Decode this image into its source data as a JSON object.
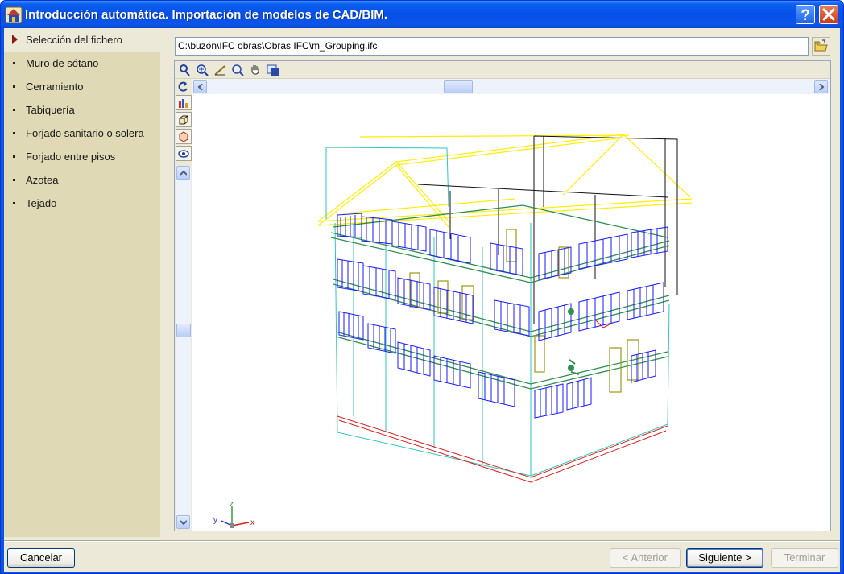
{
  "window": {
    "title": "Introducción automática. Importación de modelos de CAD/BIM.",
    "help_icon": "help-icon",
    "close_icon": "close-icon"
  },
  "nav": {
    "items": [
      {
        "label": "Selección del fichero",
        "selected": true
      },
      {
        "label": "Muro de sótano",
        "selected": false
      },
      {
        "label": "Cerramiento",
        "selected": false
      },
      {
        "label": "Tabiquería",
        "selected": false
      },
      {
        "label": "Forjado sanitario o solera",
        "selected": false
      },
      {
        "label": "Forjado entre pisos",
        "selected": false
      },
      {
        "label": "Azotea",
        "selected": false
      },
      {
        "label": "Tejado",
        "selected": false
      }
    ]
  },
  "file": {
    "path": "C:\\buzón\\IFC obras\\Obras IFC\\m_Grouping.ifc",
    "open_icon": "folder-open-icon"
  },
  "viewer": {
    "toolbar_icons": [
      "select-icon",
      "zoom-window-icon",
      "measure-icon",
      "zoom-icon",
      "pan-icon",
      "view-options-icon"
    ],
    "side_icons": [
      "rotate-icon",
      "layers-icon",
      "cube-view-icon",
      "section-icon",
      "visibility-icon"
    ],
    "axes": {
      "x": "x",
      "y": "y",
      "z": "z"
    }
  },
  "buttons": {
    "cancel": "Cancelar",
    "previous": "< Anterior",
    "next": "Siguiente >",
    "finish": "Terminar"
  },
  "colors": {
    "title_bar": "#0650e8",
    "nav_bg": "#dfd9b5",
    "windows": "#1a1aff",
    "doors": "#9a9a10",
    "slabs": "#2f8f4f",
    "walls": "#2ec4c4",
    "roof": "#ffee00",
    "base": "#d42020"
  }
}
